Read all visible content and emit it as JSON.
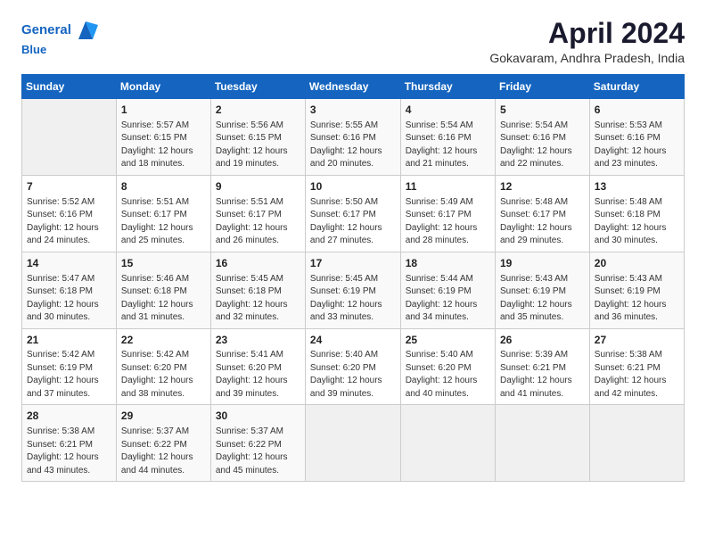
{
  "header": {
    "logo_line1": "General",
    "logo_line2": "Blue",
    "title": "April 2024",
    "subtitle": "Gokavaram, Andhra Pradesh, India"
  },
  "weekdays": [
    "Sunday",
    "Monday",
    "Tuesday",
    "Wednesday",
    "Thursday",
    "Friday",
    "Saturday"
  ],
  "weeks": [
    [
      {
        "day": "",
        "info": ""
      },
      {
        "day": "1",
        "info": "Sunrise: 5:57 AM\nSunset: 6:15 PM\nDaylight: 12 hours\nand 18 minutes."
      },
      {
        "day": "2",
        "info": "Sunrise: 5:56 AM\nSunset: 6:15 PM\nDaylight: 12 hours\nand 19 minutes."
      },
      {
        "day": "3",
        "info": "Sunrise: 5:55 AM\nSunset: 6:16 PM\nDaylight: 12 hours\nand 20 minutes."
      },
      {
        "day": "4",
        "info": "Sunrise: 5:54 AM\nSunset: 6:16 PM\nDaylight: 12 hours\nand 21 minutes."
      },
      {
        "day": "5",
        "info": "Sunrise: 5:54 AM\nSunset: 6:16 PM\nDaylight: 12 hours\nand 22 minutes."
      },
      {
        "day": "6",
        "info": "Sunrise: 5:53 AM\nSunset: 6:16 PM\nDaylight: 12 hours\nand 23 minutes."
      }
    ],
    [
      {
        "day": "7",
        "info": "Sunrise: 5:52 AM\nSunset: 6:16 PM\nDaylight: 12 hours\nand 24 minutes."
      },
      {
        "day": "8",
        "info": "Sunrise: 5:51 AM\nSunset: 6:17 PM\nDaylight: 12 hours\nand 25 minutes."
      },
      {
        "day": "9",
        "info": "Sunrise: 5:51 AM\nSunset: 6:17 PM\nDaylight: 12 hours\nand 26 minutes."
      },
      {
        "day": "10",
        "info": "Sunrise: 5:50 AM\nSunset: 6:17 PM\nDaylight: 12 hours\nand 27 minutes."
      },
      {
        "day": "11",
        "info": "Sunrise: 5:49 AM\nSunset: 6:17 PM\nDaylight: 12 hours\nand 28 minutes."
      },
      {
        "day": "12",
        "info": "Sunrise: 5:48 AM\nSunset: 6:17 PM\nDaylight: 12 hours\nand 29 minutes."
      },
      {
        "day": "13",
        "info": "Sunrise: 5:48 AM\nSunset: 6:18 PM\nDaylight: 12 hours\nand 30 minutes."
      }
    ],
    [
      {
        "day": "14",
        "info": "Sunrise: 5:47 AM\nSunset: 6:18 PM\nDaylight: 12 hours\nand 30 minutes."
      },
      {
        "day": "15",
        "info": "Sunrise: 5:46 AM\nSunset: 6:18 PM\nDaylight: 12 hours\nand 31 minutes."
      },
      {
        "day": "16",
        "info": "Sunrise: 5:45 AM\nSunset: 6:18 PM\nDaylight: 12 hours\nand 32 minutes."
      },
      {
        "day": "17",
        "info": "Sunrise: 5:45 AM\nSunset: 6:19 PM\nDaylight: 12 hours\nand 33 minutes."
      },
      {
        "day": "18",
        "info": "Sunrise: 5:44 AM\nSunset: 6:19 PM\nDaylight: 12 hours\nand 34 minutes."
      },
      {
        "day": "19",
        "info": "Sunrise: 5:43 AM\nSunset: 6:19 PM\nDaylight: 12 hours\nand 35 minutes."
      },
      {
        "day": "20",
        "info": "Sunrise: 5:43 AM\nSunset: 6:19 PM\nDaylight: 12 hours\nand 36 minutes."
      }
    ],
    [
      {
        "day": "21",
        "info": "Sunrise: 5:42 AM\nSunset: 6:19 PM\nDaylight: 12 hours\nand 37 minutes."
      },
      {
        "day": "22",
        "info": "Sunrise: 5:42 AM\nSunset: 6:20 PM\nDaylight: 12 hours\nand 38 minutes."
      },
      {
        "day": "23",
        "info": "Sunrise: 5:41 AM\nSunset: 6:20 PM\nDaylight: 12 hours\nand 39 minutes."
      },
      {
        "day": "24",
        "info": "Sunrise: 5:40 AM\nSunset: 6:20 PM\nDaylight: 12 hours\nand 39 minutes."
      },
      {
        "day": "25",
        "info": "Sunrise: 5:40 AM\nSunset: 6:20 PM\nDaylight: 12 hours\nand 40 minutes."
      },
      {
        "day": "26",
        "info": "Sunrise: 5:39 AM\nSunset: 6:21 PM\nDaylight: 12 hours\nand 41 minutes."
      },
      {
        "day": "27",
        "info": "Sunrise: 5:38 AM\nSunset: 6:21 PM\nDaylight: 12 hours\nand 42 minutes."
      }
    ],
    [
      {
        "day": "28",
        "info": "Sunrise: 5:38 AM\nSunset: 6:21 PM\nDaylight: 12 hours\nand 43 minutes."
      },
      {
        "day": "29",
        "info": "Sunrise: 5:37 AM\nSunset: 6:22 PM\nDaylight: 12 hours\nand 44 minutes."
      },
      {
        "day": "30",
        "info": "Sunrise: 5:37 AM\nSunset: 6:22 PM\nDaylight: 12 hours\nand 45 minutes."
      },
      {
        "day": "",
        "info": ""
      },
      {
        "day": "",
        "info": ""
      },
      {
        "day": "",
        "info": ""
      },
      {
        "day": "",
        "info": ""
      }
    ]
  ]
}
